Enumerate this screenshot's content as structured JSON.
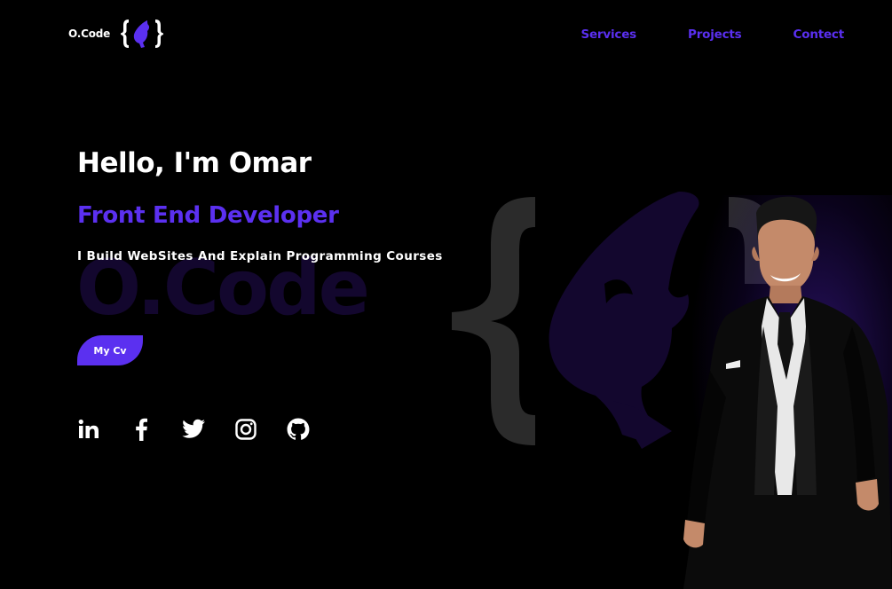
{
  "header": {
    "logo_text": "O.Code",
    "nav": [
      {
        "label": "Services"
      },
      {
        "label": "Projects"
      },
      {
        "label": "Contect"
      }
    ]
  },
  "hero": {
    "greeting": "Hello, I'm Omar",
    "role": "Front End Developer",
    "description": "I Build WebSites And Explain Programming Courses",
    "cv_button": "My Cv",
    "watermark": "O.Code"
  },
  "socials": [
    {
      "icon": "linkedin-icon"
    },
    {
      "icon": "facebook-icon"
    },
    {
      "icon": "twitter-icon"
    },
    {
      "icon": "instagram-icon"
    },
    {
      "icon": "github-icon"
    }
  ],
  "colors": {
    "accent": "#5b30f0",
    "background": "#000000",
    "watermark": "#13072e"
  }
}
